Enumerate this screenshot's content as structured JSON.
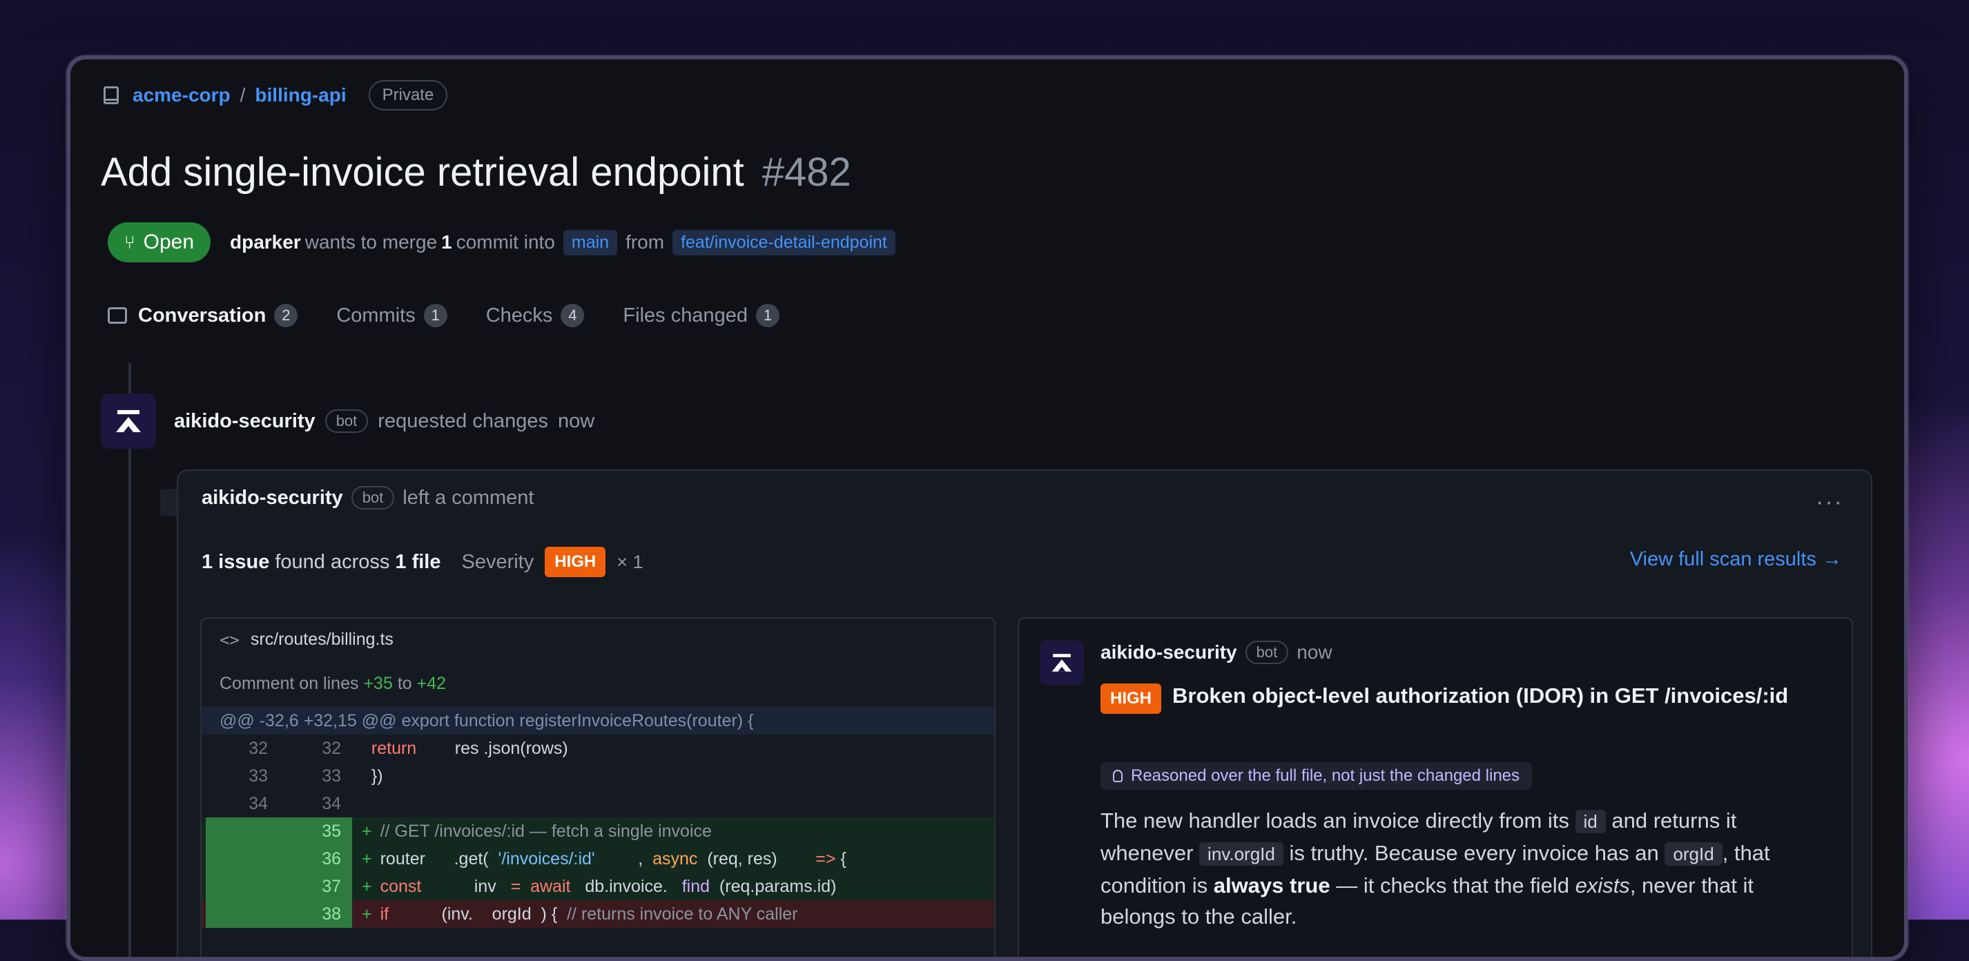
{
  "repo": {
    "owner": "acme-corp",
    "separator": "/",
    "name": "billing-api",
    "visibility": "Private"
  },
  "pr": {
    "title": "Add single-invoice retrieval endpoint",
    "number": "#482",
    "status": "Open",
    "author": "dparker",
    "text_wants": "wants to merge",
    "commit_count": "1",
    "text_commit_into": "commit into",
    "base_branch": "main",
    "text_from": "from",
    "head_branch": "feat/invoice-detail-endpoint"
  },
  "tabs": [
    {
      "label": "Conversation",
      "count": "2"
    },
    {
      "label": "Commits",
      "count": "1"
    },
    {
      "label": "Checks",
      "count": "4"
    },
    {
      "label": "Files changed",
      "count": "1"
    }
  ],
  "event": {
    "user": "aikido-security",
    "badge": "bot",
    "action": "requested changes",
    "time": "now"
  },
  "comment": {
    "user": "aikido-security",
    "badge": "bot",
    "action": "left a comment",
    "more": "···",
    "summary": {
      "issues": "1 issue",
      "found_text": "found across",
      "files": "1 file",
      "severity_label": "Severity",
      "severity": "HIGH",
      "severity_count": "× 1"
    },
    "view_link": "View full scan results →"
  },
  "code": {
    "file_path": "src/routes/billing.ts",
    "comment_prefix": "Comment on lines",
    "line_from": "+35",
    "line_to_word": "to",
    "line_to": "+42",
    "hunk": "@@ -32,6 +32,15 @@ export function registerInvoiceRoutes(router) {",
    "ctx_lines": [
      {
        "old": "32",
        "new": "32"
      },
      {
        "old": "33",
        "new": "33"
      },
      {
        "old": "34",
        "new": "34"
      }
    ],
    "add_lines": [
      {
        "new": "35"
      },
      {
        "new": "36"
      },
      {
        "new": "37"
      },
      {
        "new": "38"
      }
    ],
    "tokens": {
      "return_kw": "return",
      "return_rest": "res .json(rows)",
      "close": "})",
      "comment35": "// GET /invoices/:id — fetch a single invoice",
      "router": "router",
      "get": ".get(",
      "route": "'/invoices/:id'",
      "comma": ",",
      "async": "async",
      "params": "(req, res)",
      "arrow": "=>",
      "brace": "{",
      "const": "const",
      "inv": "inv",
      "eq": "=",
      "await": "await",
      "db": "db.invoice.",
      "find": "find",
      "findargs": "(req.params.id)",
      "if": "if",
      "cond": "(inv.    orgId  ) {",
      "comment38": "// returns invoice to ANY caller",
      "plus": "+"
    }
  },
  "finding": {
    "user": "aikido-security",
    "badge": "bot",
    "time": "now",
    "severity": "HIGH",
    "title_a": "Broken object-level authorization (IDOR) in",
    "title_b": "GET /invoices/:id",
    "reason": "Reasoned over the full file, not just the changed lines",
    "body": {
      "t1": "The new handler loads an invoice directly from its",
      "c1": "id",
      "t2": "and returns it whenever",
      "c2": "inv.orgId",
      "t3": "is truthy. Because every invoice has an",
      "c3": "orgId",
      "t4": ", that condition is",
      "b1": "always true",
      "t5": "— it checks that the field",
      "i1": "exists",
      "t6": ", never that it belongs to the caller."
    }
  }
}
